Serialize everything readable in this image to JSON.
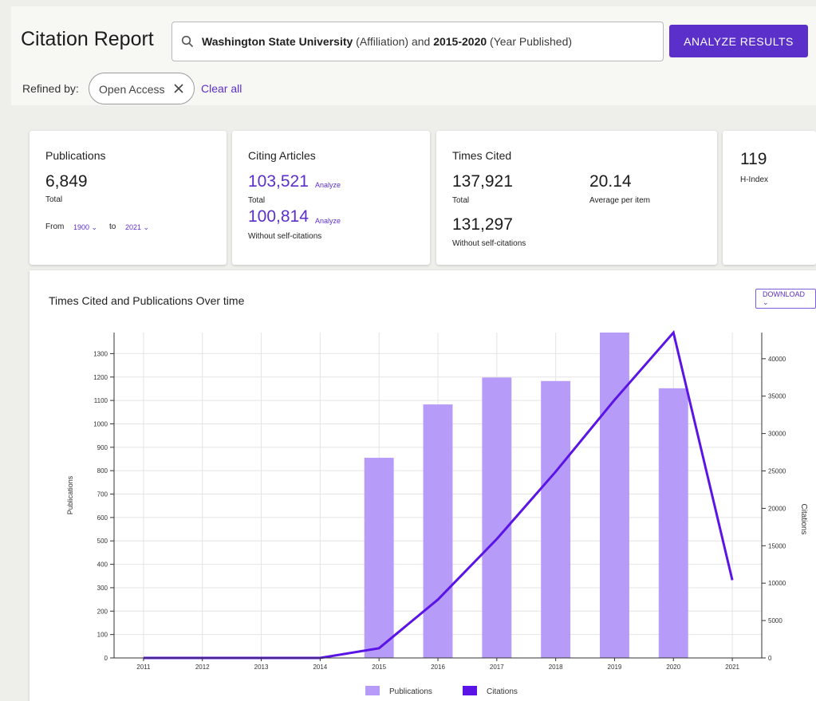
{
  "header": {
    "title": "Citation Report",
    "search": {
      "parts": [
        {
          "text": "Washington State University",
          "bold": true
        },
        {
          "text": " (Affiliation) and ",
          "bold": false
        },
        {
          "text": "2015-2020",
          "bold": true
        },
        {
          "text": " (Year Published)",
          "bold": false
        }
      ]
    },
    "analyze_button": "ANALYZE RESULTS",
    "refined_label": "Refined by:",
    "chip_label": "Open Access",
    "clear_all": "Clear all"
  },
  "cards": {
    "publications": {
      "label": "Publications",
      "value": "6,849",
      "sub": "Total",
      "from_label": "From",
      "from_year": "1900",
      "to_label": "to",
      "to_year": "2021"
    },
    "citing": {
      "label": "Citing Articles",
      "value1": "103,521",
      "sub1": "Total",
      "value2": "100,814",
      "sub2": "Without self-citations",
      "analyze": "Analyze"
    },
    "times_cited": {
      "label": "Times Cited",
      "value1": "137,921",
      "sub1": "Total",
      "avg": "20.14",
      "avg_sub": "Average per item",
      "value2": "131,297",
      "sub2": "Without self-citations"
    },
    "hindex": {
      "value": "119",
      "label": "H-Index"
    }
  },
  "chart": {
    "title": "Times Cited and Publications Over time",
    "download": "DOWNLOAD"
  },
  "chart_data": {
    "type": "bar",
    "categories": [
      "2011",
      "2012",
      "2013",
      "2014",
      "2015",
      "2016",
      "2017",
      "2018",
      "2019",
      "2020",
      "2021"
    ],
    "series": [
      {
        "name": "Publications",
        "type": "bar",
        "axis": "left",
        "color": "#b79bf8",
        "values": [
          0,
          0,
          0,
          0,
          855,
          1083,
          1198,
          1183,
          1390,
          1152,
          0
        ]
      },
      {
        "name": "Citations",
        "type": "line",
        "axis": "right",
        "color": "#5b14e6",
        "values": [
          0,
          0,
          0,
          0,
          1300,
          7800,
          15900,
          24900,
          34500,
          43500,
          10400
        ]
      }
    ],
    "ylabel": "Publications",
    "y2label": "Citations",
    "ylim": [
      0,
      1390
    ],
    "y2lim": [
      0,
      43500
    ],
    "yticks": [
      0,
      100,
      200,
      300,
      400,
      500,
      600,
      700,
      800,
      900,
      1000,
      1100,
      1200,
      1300
    ],
    "y2ticks": [
      0,
      5000,
      10000,
      15000,
      20000,
      25000,
      30000,
      35000,
      40000
    ],
    "grid": true,
    "legend": "bottom"
  }
}
